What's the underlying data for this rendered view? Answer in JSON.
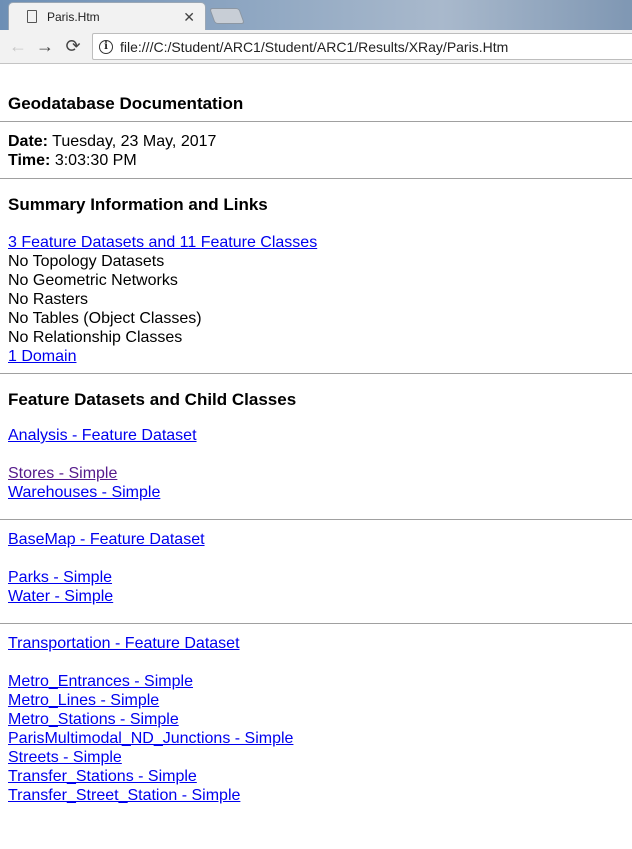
{
  "browser": {
    "tab_title": "Paris.Htm",
    "url": "file:///C:/Student/ARC1/Student/ARC1/Results/XRay/Paris.Htm"
  },
  "page": {
    "title": "Geodatabase Documentation",
    "date_label": "Date:",
    "date_value": " Tuesday, 23 May, 2017",
    "time_label": "Time:",
    "time_value": " 3:03:30 PM",
    "summary_heading": "Summary Information and Links",
    "summary_items": [
      {
        "text": "3 Feature Datasets and 11 Feature Classes",
        "link": true
      },
      {
        "text": "No Topology Datasets",
        "link": false
      },
      {
        "text": "No Geometric Networks",
        "link": false
      },
      {
        "text": "No Rasters",
        "link": false
      },
      {
        "text": "No Tables (Object Classes)",
        "link": false
      },
      {
        "text": "No Relationship Classes",
        "link": false
      },
      {
        "text": "1 Domain",
        "link": true
      }
    ],
    "datasets_heading": "Feature Datasets and Child Classes",
    "datasets": [
      {
        "name": "Analysis - Feature Dataset",
        "classes": [
          "Stores - Simple",
          "Warehouses - Simple"
        ]
      },
      {
        "name": "BaseMap - Feature Dataset",
        "classes": [
          "Parks - Simple",
          "Water - Simple"
        ]
      },
      {
        "name": "Transportation - Feature Dataset",
        "classes": [
          "Metro_Entrances - Simple",
          "Metro_Lines - Simple",
          "Metro_Stations - Simple",
          "ParisMultimodal_ND_Junctions - Simple",
          "Streets - Simple",
          "Transfer_Stations - Simple",
          "Transfer_Street_Station - Simple"
        ]
      }
    ],
    "colors": {
      "link": "#0000ee",
      "visited_link": "#551a8b"
    }
  }
}
